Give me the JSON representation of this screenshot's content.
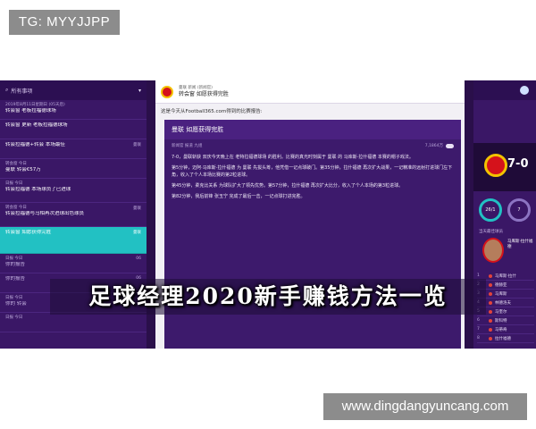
{
  "watermarks": {
    "top_left": "TG: MYYJJPP",
    "bottom_right": "www.dingdangyuncang.com"
  },
  "banner": {
    "title": "足球经理2020新手赚钱方法一览"
  },
  "inbox": {
    "header": "所有事项",
    "toggle": "▾",
    "items": [
      {
        "date": "2019年8月11日星期日 (05天后)",
        "title": "转会窗 老板拉福德球场",
        "sender": "",
        "state": "normal"
      },
      {
        "date": "",
        "title": "转会窗 更新 老板拉福德球场",
        "sender": "",
        "state": "normal"
      },
      {
        "date": "",
        "title": "转会拉福德+转会 本场最佳",
        "sender": "曼联",
        "state": "normal"
      },
      {
        "date": "转会窗 今日",
        "title": "曼联 转会€57万",
        "sender": "",
        "state": "normal"
      },
      {
        "date": "日报 今日",
        "title": "转会拉福德 本场球员了已进球",
        "sender": "",
        "state": "tall"
      },
      {
        "date": "转会窗 今日",
        "title": "转会拉福德与马相再次进球出色球员",
        "sender": "曼联",
        "state": "tall"
      },
      {
        "date": "",
        "title": "转会窗 如愿获得完胜",
        "sender": "曼联",
        "state": "selected"
      },
      {
        "date": "日报 今日",
        "title": "你的报告",
        "sender": "06",
        "state": "dim"
      },
      {
        "date": "",
        "title": "你的报告",
        "sender": "06",
        "state": "dim"
      },
      {
        "date": "日报 今日",
        "title": "你的 转会",
        "sender": "",
        "state": "dim"
      },
      {
        "date": "日报 今日",
        "title": "",
        "sender": "",
        "state": "dim"
      }
    ]
  },
  "message": {
    "from": "曼联 新闻 (新闻官)",
    "subject": "转会窗 如愿获得完胜",
    "intro": "这是今天从Football365.com得到的比赛报告:",
    "article_title": "曼联 如愿获得完胜",
    "byline_left": "新闻官 报道 九组",
    "byline_right": "7,1864万",
    "paragraphs": [
      "7-0，曼联斩获 双庆今天晚上在 老特拉福德球场 的胜利。比赛的真光时刻属于 曼联 的 马库斯·拉什福德 本赛的帽子戏法。",
      "第5分钟，迈阿·马库斯·拉什福德 为 曼联 先拔头筹，他凭借一记点球破门。第35分钟，拉什福德 再次扩大战果，一记精准的远射打进球门左下角，收入了个人本场比赛的第2粒进球。",
      "第45分钟，柔克比关系 为球队扩大了领先优势。第57分钟，拉什福德 再次扩大比分，收入了个人本场的第3粒进球。",
      "第82分钟，我后前锋 张玉宁 完成了最后一击，一记点球打进完胜。"
    ]
  },
  "side": {
    "score": "7-0",
    "ring_left": "26/1",
    "ring_right": "7",
    "player_label": "当天最佳球员",
    "player_name": "马库斯·拉什福德",
    "lineup": [
      {
        "num": "1",
        "name": "马库斯·拉什"
      },
      {
        "num": "2",
        "name": "德赫亚"
      },
      {
        "num": "3",
        "name": "马库斯"
      },
      {
        "num": "4",
        "name": "林德洛夫"
      },
      {
        "num": "5",
        "name": "马奎尔"
      },
      {
        "num": "6",
        "name": "斯科特"
      },
      {
        "num": "7",
        "name": "马蒂奇"
      },
      {
        "num": "8",
        "name": "拉什福德"
      }
    ]
  }
}
